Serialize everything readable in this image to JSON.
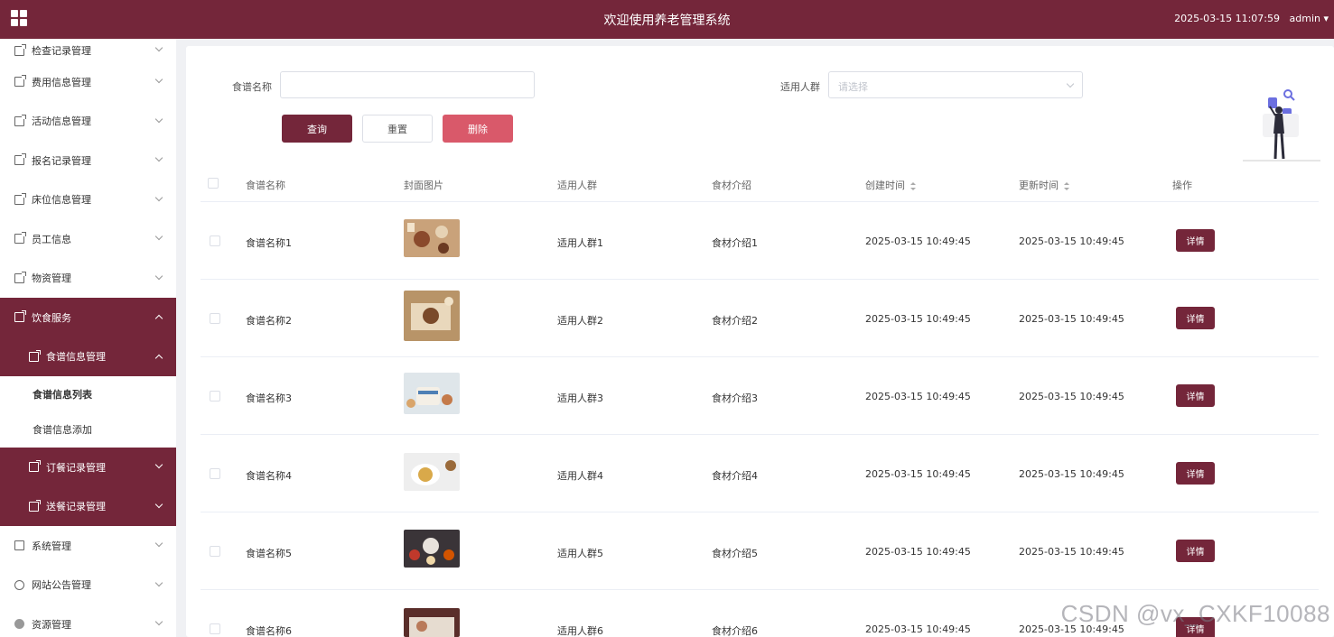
{
  "header": {
    "title": "欢迎使用养老管理系统",
    "datetime": "2025-03-15 11:07:59",
    "user": "admin"
  },
  "sidebar": {
    "items": [
      {
        "label": "检查记录管理"
      },
      {
        "label": "费用信息管理"
      },
      {
        "label": "活动信息管理"
      },
      {
        "label": "报名记录管理"
      },
      {
        "label": "床位信息管理"
      },
      {
        "label": "员工信息"
      },
      {
        "label": "物资管理"
      },
      {
        "label": "饮食服务"
      },
      {
        "label": "食谱信息管理"
      },
      {
        "label": "食谱信息列表"
      },
      {
        "label": "食谱信息添加"
      },
      {
        "label": "订餐记录管理"
      },
      {
        "label": "送餐记录管理"
      },
      {
        "label": "系统管理"
      },
      {
        "label": "网站公告管理"
      },
      {
        "label": "资源管理"
      }
    ]
  },
  "search": {
    "name_label": "食谱名称",
    "name_value": "",
    "group_label": "适用人群",
    "group_placeholder": "请选择",
    "query_label": "查询",
    "reset_label": "重置",
    "delete_label": "删除"
  },
  "table": {
    "headers": [
      "食谱名称",
      "封面图片",
      "适用人群",
      "食材介绍",
      "创建时间",
      "更新时间",
      "操作"
    ],
    "detail_label": "详情",
    "rows": [
      {
        "name": "食谱名称1",
        "group": "适用人群1",
        "intro": "食材介绍1",
        "created": "2025-03-15 10:49:45",
        "updated": "2025-03-15 10:49:45"
      },
      {
        "name": "食谱名称2",
        "group": "适用人群2",
        "intro": "食材介绍2",
        "created": "2025-03-15 10:49:45",
        "updated": "2025-03-15 10:49:45"
      },
      {
        "name": "食谱名称3",
        "group": "适用人群3",
        "intro": "食材介绍3",
        "created": "2025-03-15 10:49:45",
        "updated": "2025-03-15 10:49:45"
      },
      {
        "name": "食谱名称4",
        "group": "适用人群4",
        "intro": "食材介绍4",
        "created": "2025-03-15 10:49:45",
        "updated": "2025-03-15 10:49:45"
      },
      {
        "name": "食谱名称5",
        "group": "适用人群5",
        "intro": "食材介绍5",
        "created": "2025-03-15 10:49:45",
        "updated": "2025-03-15 10:49:45"
      },
      {
        "name": "食谱名称6",
        "group": "适用人群6",
        "intro": "食材介绍6",
        "created": "2025-03-15 10:49:45",
        "updated": "2025-03-15 10:49:45"
      }
    ]
  },
  "colors": {
    "brand": "#74263a",
    "danger": "#d9596a"
  },
  "watermark": "CSDN @vx_CXKF10088"
}
